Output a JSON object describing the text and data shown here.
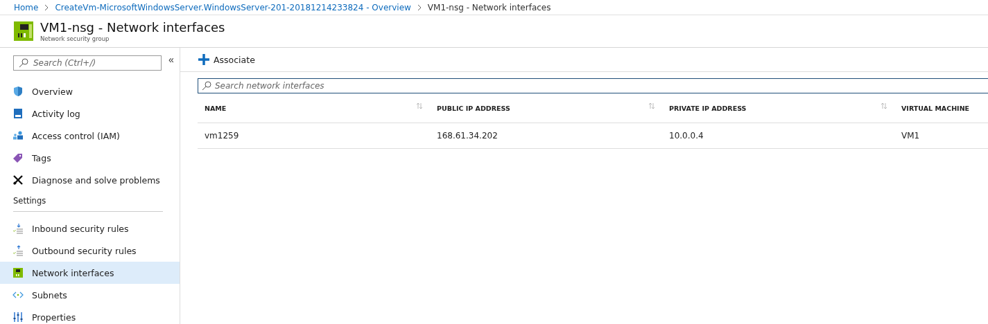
{
  "breadcrumb": [
    {
      "label": "Home"
    },
    {
      "label": "CreateVm-MicrosoftWindowsServer.WindowsServer-201-20181214233824 - Overview"
    },
    {
      "label": "VM1-nsg - Network interfaces",
      "current": true
    }
  ],
  "header": {
    "title": "VM1-nsg - Network interfaces",
    "subtitle": "Network security group"
  },
  "sidebar": {
    "search": {
      "placeholder": "Search (Ctrl+/)"
    },
    "collapse": "«",
    "sections": [
      {
        "items": [
          {
            "label": "Overview",
            "kind": "shield",
            "selected": false
          },
          {
            "label": "Activity log",
            "kind": "log",
            "selected": false
          },
          {
            "label": "Access control (IAM)",
            "kind": "people",
            "selected": false
          },
          {
            "label": "Tags",
            "kind": "tag",
            "selected": false
          },
          {
            "label": "Diagnose and solve problems",
            "kind": "tools",
            "selected": false
          }
        ]
      },
      {
        "heading": "Settings",
        "items": [
          {
            "label": "Inbound security rules",
            "kind": "inbound",
            "selected": false
          },
          {
            "label": "Outbound security rules",
            "kind": "outbound",
            "selected": false
          },
          {
            "label": "Network interfaces",
            "kind": "nic",
            "selected": true
          },
          {
            "label": "Subnets",
            "kind": "subnet",
            "selected": false
          },
          {
            "label": "Properties",
            "kind": "sliders",
            "selected": false
          }
        ]
      }
    ]
  },
  "toolbar": [
    {
      "label": "Associate"
    }
  ],
  "search": {
    "placeholder": "Search network interfaces"
  },
  "table": {
    "columns": [
      {
        "label": "NAME",
        "sortable": true
      },
      {
        "label": "PUBLIC IP ADDRESS",
        "sortable": true
      },
      {
        "label": "PRIVATE IP ADDRESS",
        "sortable": true
      },
      {
        "label": "VIRTUAL MACHINE",
        "sortable": false
      }
    ],
    "rows": [
      [
        "vm1259",
        "168.61.34.202",
        "10.0.0.4",
        "VM1"
      ]
    ]
  }
}
